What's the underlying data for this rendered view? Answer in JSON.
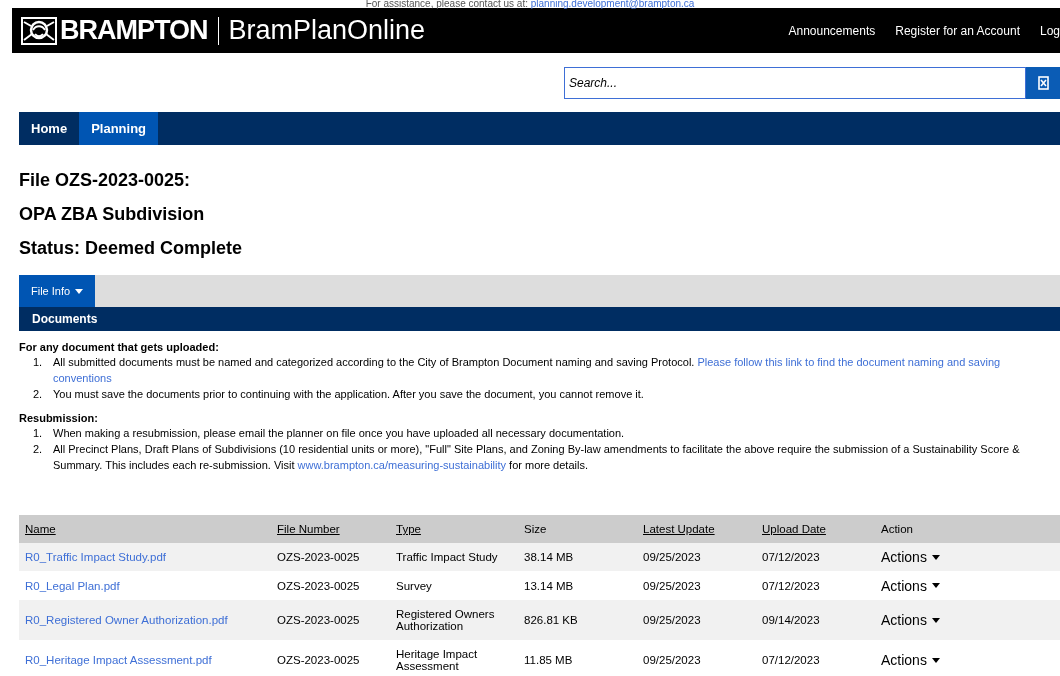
{
  "assist_note": {
    "text": "For assistance, please contact us at: ",
    "email": "planning.development@brampton.ca"
  },
  "header": {
    "logo": "BRAMPTON",
    "app_name": "BramPlanOnline",
    "links": [
      "Announcements",
      "Register for an Account",
      "Log"
    ]
  },
  "search": {
    "placeholder": "Search..."
  },
  "nav": [
    {
      "label": "Home",
      "selected": false
    },
    {
      "label": "Planning",
      "selected": true
    }
  ],
  "headings": [
    "File OZS-2023-0025:",
    "OPA ZBA Subdivision",
    "Status: Deemed Complete"
  ],
  "tabs": [
    {
      "label": "File Info",
      "selected": true
    }
  ],
  "section_title": "Documents",
  "instructions": [
    {
      "title": "For any document that gets uploaded:",
      "items": [
        {
          "number": "1.",
          "text": "All submitted documents must be named and categorized according to the City of Brampton Document naming and saving Protocol. ",
          "link_lines": [
            "Please follow this link to find the document naming and saving",
            "conventions"
          ]
        },
        {
          "number": "2.",
          "text": "You must save the documents prior to continuing with the application. After you save the document, you cannot remove it."
        }
      ]
    },
    {
      "title": "Resubmission:",
      "items": [
        {
          "number": "1.",
          "text": "When making a resubmission, please email the planner on file once you have uploaded all necessary documentation."
        },
        {
          "number": "2.",
          "text": "All Precinct Plans, Draft Plans of Subdivisions (10 residential units or more), \"Full\" Site Plans, and Zoning By-law amendments to facilitate the above require the submission of a Sustainability Score & Summary. This includes each re-submission. Visit ",
          "link": "www.brampton.ca/measuring-sustainability",
          "after": " for more details."
        }
      ]
    }
  ],
  "table": {
    "columns": [
      {
        "label": "Name",
        "sortable": true
      },
      {
        "label": "File Number",
        "sortable": true
      },
      {
        "label": "Type",
        "sortable": true
      },
      {
        "label": "Size",
        "sortable": false
      },
      {
        "label": "Latest Update",
        "sortable": true
      },
      {
        "label": "Upload Date",
        "sortable": true
      },
      {
        "label": "Action",
        "sortable": false
      }
    ],
    "rows": [
      {
        "name": "R0_Traffic Impact Study.pdf",
        "file_number": "OZS-2023-0025",
        "type": "Traffic Impact Study",
        "size": "38.14 MB",
        "latest_update": "09/25/2023",
        "upload_date": "07/12/2023",
        "action": "Actions"
      },
      {
        "name": "R0_Legal Plan.pdf",
        "file_number": "OZS-2023-0025",
        "type": "Survey",
        "size": "13.14 MB",
        "latest_update": "09/25/2023",
        "upload_date": "07/12/2023",
        "action": "Actions"
      },
      {
        "name": "R0_Registered Owner Authorization.pdf",
        "file_number": "OZS-2023-0025",
        "type": "Registered Owners Authorization",
        "size": "826.81 KB",
        "latest_update": "09/25/2023",
        "upload_date": "09/14/2023",
        "action": "Actions"
      },
      {
        "name": "R0_Heritage Impact Assessment.pdf",
        "file_number": "OZS-2023-0025",
        "type": "Heritage Impact Assessment",
        "size": "11.85 MB",
        "latest_update": "09/25/2023",
        "upload_date": "07/12/2023",
        "action": "Actions"
      }
    ]
  }
}
